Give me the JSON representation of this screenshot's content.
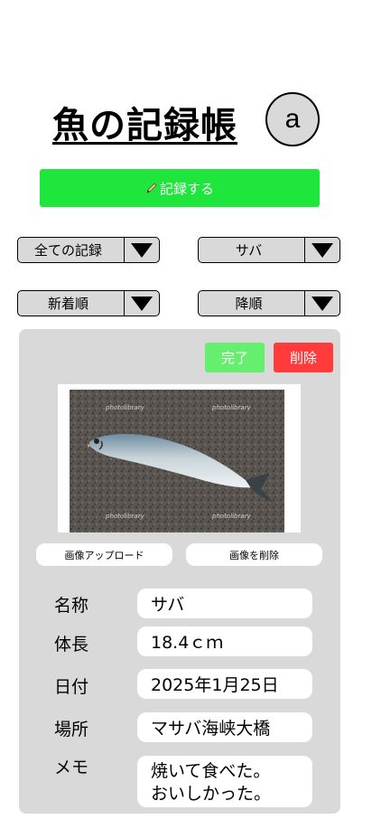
{
  "header": {
    "title": "魚の記録帳",
    "avatar_letter": "a"
  },
  "record_button": {
    "label": "記録する",
    "icon": "pencil-icon"
  },
  "filters": {
    "record_scope": "全ての記録",
    "species": "サバ",
    "sort_by": "新着順",
    "order": "降順"
  },
  "card": {
    "done_label": "完了",
    "delete_label": "削除",
    "upload_label": "画像アップロード",
    "remove_image_label": "画像を削除",
    "image_watermarks": [
      "photolibrary",
      "photolibrary",
      "photolibrary",
      "photolibrary"
    ],
    "fields": {
      "name_label": "名称",
      "name_value": "サバ",
      "length_label": "体長",
      "length_value": "18.4ｃｍ",
      "date_label": "日付",
      "date_value": "2025年1月25日",
      "place_label": "場所",
      "place_value": "マサバ海峡大橋",
      "memo_label": "メモ",
      "memo_value": "焼いて食べた。\nおいしかった。"
    }
  },
  "colors": {
    "record_button": "#1ee63c",
    "done_button": "#66ef6e",
    "delete_button": "#ff3b3b",
    "card_background": "#d9d9d9"
  }
}
